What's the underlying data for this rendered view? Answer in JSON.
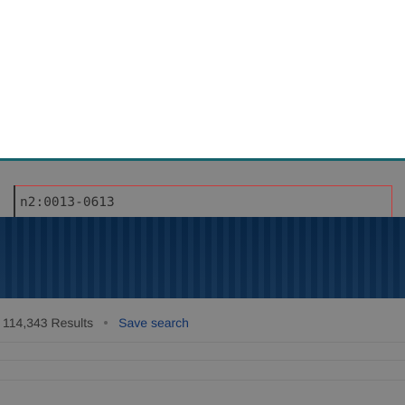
{
  "search": {
    "value": "n2:0013-0613"
  },
  "results": {
    "count_label": "114,343 Results",
    "save_search_label": "Save search"
  },
  "colors": {
    "accent_strip": "#16616a",
    "banner": "#08284a",
    "input_border": "#c83a3a",
    "link": "#0f2f63",
    "overlay_gray": "#858585"
  }
}
